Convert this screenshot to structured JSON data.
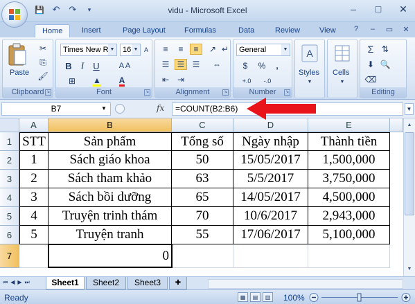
{
  "window": {
    "title": "vidu - Microsoft Excel",
    "minimize": "–",
    "restore": "□",
    "close": "✕"
  },
  "qat": {
    "save": "💾",
    "undo": "↶",
    "redo": "↷",
    "more": "▾"
  },
  "tabs": [
    {
      "label": "Home",
      "active": true
    },
    {
      "label": "Insert"
    },
    {
      "label": "Page Layout"
    },
    {
      "label": "Formulas"
    },
    {
      "label": "Data"
    },
    {
      "label": "Review"
    },
    {
      "label": "View"
    }
  ],
  "help": {
    "help": "?",
    "min": "–",
    "restore": "▭",
    "close": "✕"
  },
  "ribbon": {
    "clipboard": {
      "label": "Clipboard",
      "paste": "Paste"
    },
    "font": {
      "label": "Font",
      "name": "Times New Ro",
      "size": "16",
      "bold": "B",
      "italic": "I",
      "underline": "U"
    },
    "alignment": {
      "label": "Alignment"
    },
    "number": {
      "label": "Number",
      "format": "General",
      "currency": "$",
      "percent": "%",
      "comma": ",",
      "inc": "+.0",
      "dec": "-.0"
    },
    "styles": {
      "label": "Styles"
    },
    "cells": {
      "label": "Cells"
    },
    "editing": {
      "label": "Editing",
      "sum": "Σ"
    }
  },
  "formula_bar": {
    "name_box": "B7",
    "fx": "fx",
    "formula": "=COUNT(B2:B6)"
  },
  "grid": {
    "columns": [
      "A",
      "B",
      "C",
      "D",
      "E"
    ],
    "rows": [
      "1",
      "2",
      "3",
      "4",
      "5",
      "6",
      "7"
    ],
    "selected_column": "B",
    "selected_row": "7",
    "header": [
      "STT",
      "Sản phẩm",
      "Tổng số",
      "Ngày nhập",
      "Thành tiền"
    ],
    "data": [
      [
        "1",
        "Sách giáo khoa",
        "50",
        "15/05/2017",
        "1,500,000"
      ],
      [
        "2",
        "Sách tham khảo",
        "63",
        "5/5/2017",
        "3,750,000"
      ],
      [
        "3",
        "Sách bồi dưỡng",
        "65",
        "14/05/2017",
        "4,500,000"
      ],
      [
        "4",
        "Truyện trinh thám",
        "70",
        "10/6/2017",
        "2,943,000"
      ],
      [
        "5",
        "Truyện tranh",
        "55",
        "17/06/2017",
        "5,100,000"
      ]
    ],
    "result_cell": "0"
  },
  "sheets": [
    {
      "label": "Sheet1",
      "active": true
    },
    {
      "label": "Sheet2"
    },
    {
      "label": "Sheet3"
    }
  ],
  "status": {
    "ready": "Ready",
    "zoom": "100%"
  },
  "colors": {
    "accent": "#15428b",
    "selection": "#f1c15f",
    "arrow": "#e8141a"
  }
}
